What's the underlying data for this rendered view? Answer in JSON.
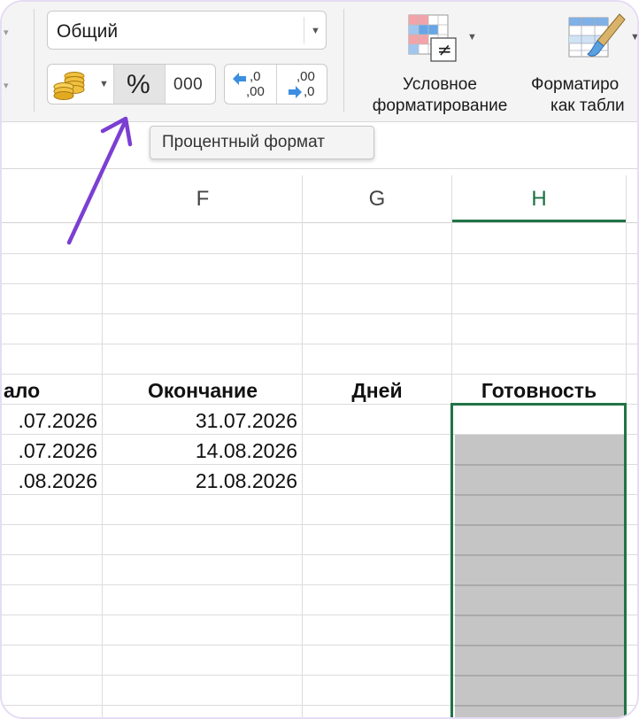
{
  "ribbon": {
    "number_format_value": "Общий",
    "percent_label": "%",
    "thousands_label": "000",
    "increase_decimal_top": ",0",
    "increase_decimal_bottom": ",00",
    "decrease_decimal_top": ",00",
    "decrease_decimal_bottom": ",0",
    "conditional_format_label_line1": "Условное",
    "conditional_format_label_line2": "форматирование",
    "format_table_label_line1": "Форматиро",
    "format_table_label_line2": "как табли",
    "tooltip": "Процентный формат"
  },
  "columns": [
    "F",
    "G",
    "H"
  ],
  "table": {
    "headers": {
      "start": "ало",
      "end": "Окончание",
      "days": "Дней",
      "progress": "Готовность"
    },
    "rows": [
      {
        "start": ".07.2026",
        "end": "31.07.2026",
        "days": ""
      },
      {
        "start": ".07.2026",
        "end": "14.08.2026",
        "days": ""
      },
      {
        "start": ".08.2026",
        "end": "21.08.2026",
        "days": ""
      }
    ]
  },
  "colors": {
    "accent_green": "#217346",
    "annotation_arrow": "#7b3fd3",
    "frame": "#e6dcf4"
  }
}
